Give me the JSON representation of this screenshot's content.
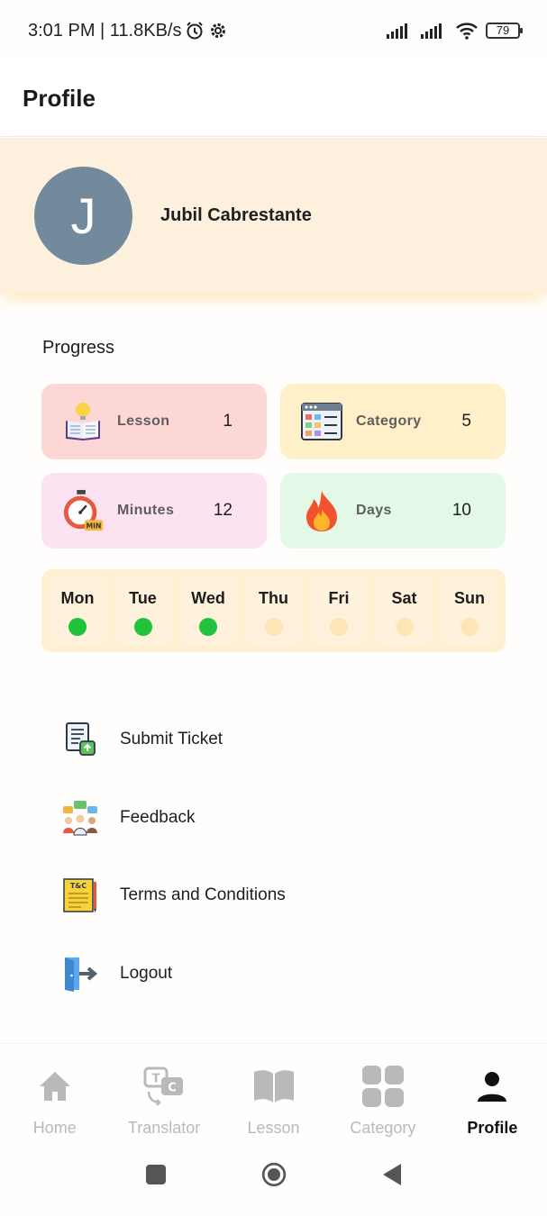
{
  "status_bar": {
    "time_speed": "3:01 PM | 11.8KB/s",
    "battery": "79"
  },
  "app_bar": {
    "title": "Profile"
  },
  "profile": {
    "initial": "J",
    "name": "Jubil Cabrestante"
  },
  "progress": {
    "title": "Progress",
    "stats": [
      {
        "label": "Lesson",
        "value": "1",
        "icon": "open-book-bulb-icon"
      },
      {
        "label": "Category",
        "value": "5",
        "icon": "category-grid-icon"
      },
      {
        "label": "Minutes",
        "value": "12",
        "icon": "stopwatch-icon"
      },
      {
        "label": "Days",
        "value": "10",
        "icon": "fire-icon"
      }
    ],
    "week": [
      {
        "day": "Mon",
        "done": true
      },
      {
        "day": "Tue",
        "done": true
      },
      {
        "day": "Wed",
        "done": true
      },
      {
        "day": "Thu",
        "done": false
      },
      {
        "day": "Fri",
        "done": false
      },
      {
        "day": "Sat",
        "done": false
      },
      {
        "day": "Sun",
        "done": false
      }
    ]
  },
  "menu": [
    {
      "label": "Submit Ticket",
      "icon": "ticket-document-icon"
    },
    {
      "label": "Feedback",
      "icon": "feedback-people-icon"
    },
    {
      "label": "Terms and Conditions",
      "icon": "terms-document-icon"
    },
    {
      "label": "Logout",
      "icon": "logout-door-icon"
    }
  ],
  "bottom_nav": [
    {
      "label": "Home",
      "icon": "home-icon",
      "active": false
    },
    {
      "label": "Translator",
      "icon": "translator-icon",
      "active": false
    },
    {
      "label": "Lesson",
      "icon": "book-icon",
      "active": false
    },
    {
      "label": "Category",
      "icon": "grid-icon",
      "active": false
    },
    {
      "label": "Profile",
      "icon": "person-icon",
      "active": true
    }
  ],
  "colors": {
    "profile_bg": "#fdf1de",
    "avatar": "#728a9b",
    "lesson_card": "#fdd6d6",
    "category_card": "#fff0c9",
    "minutes_card": "#fde2f1",
    "days_card": "#e4f8e7",
    "day_done": "#21c23c",
    "day_pending": "#fde5b5"
  }
}
